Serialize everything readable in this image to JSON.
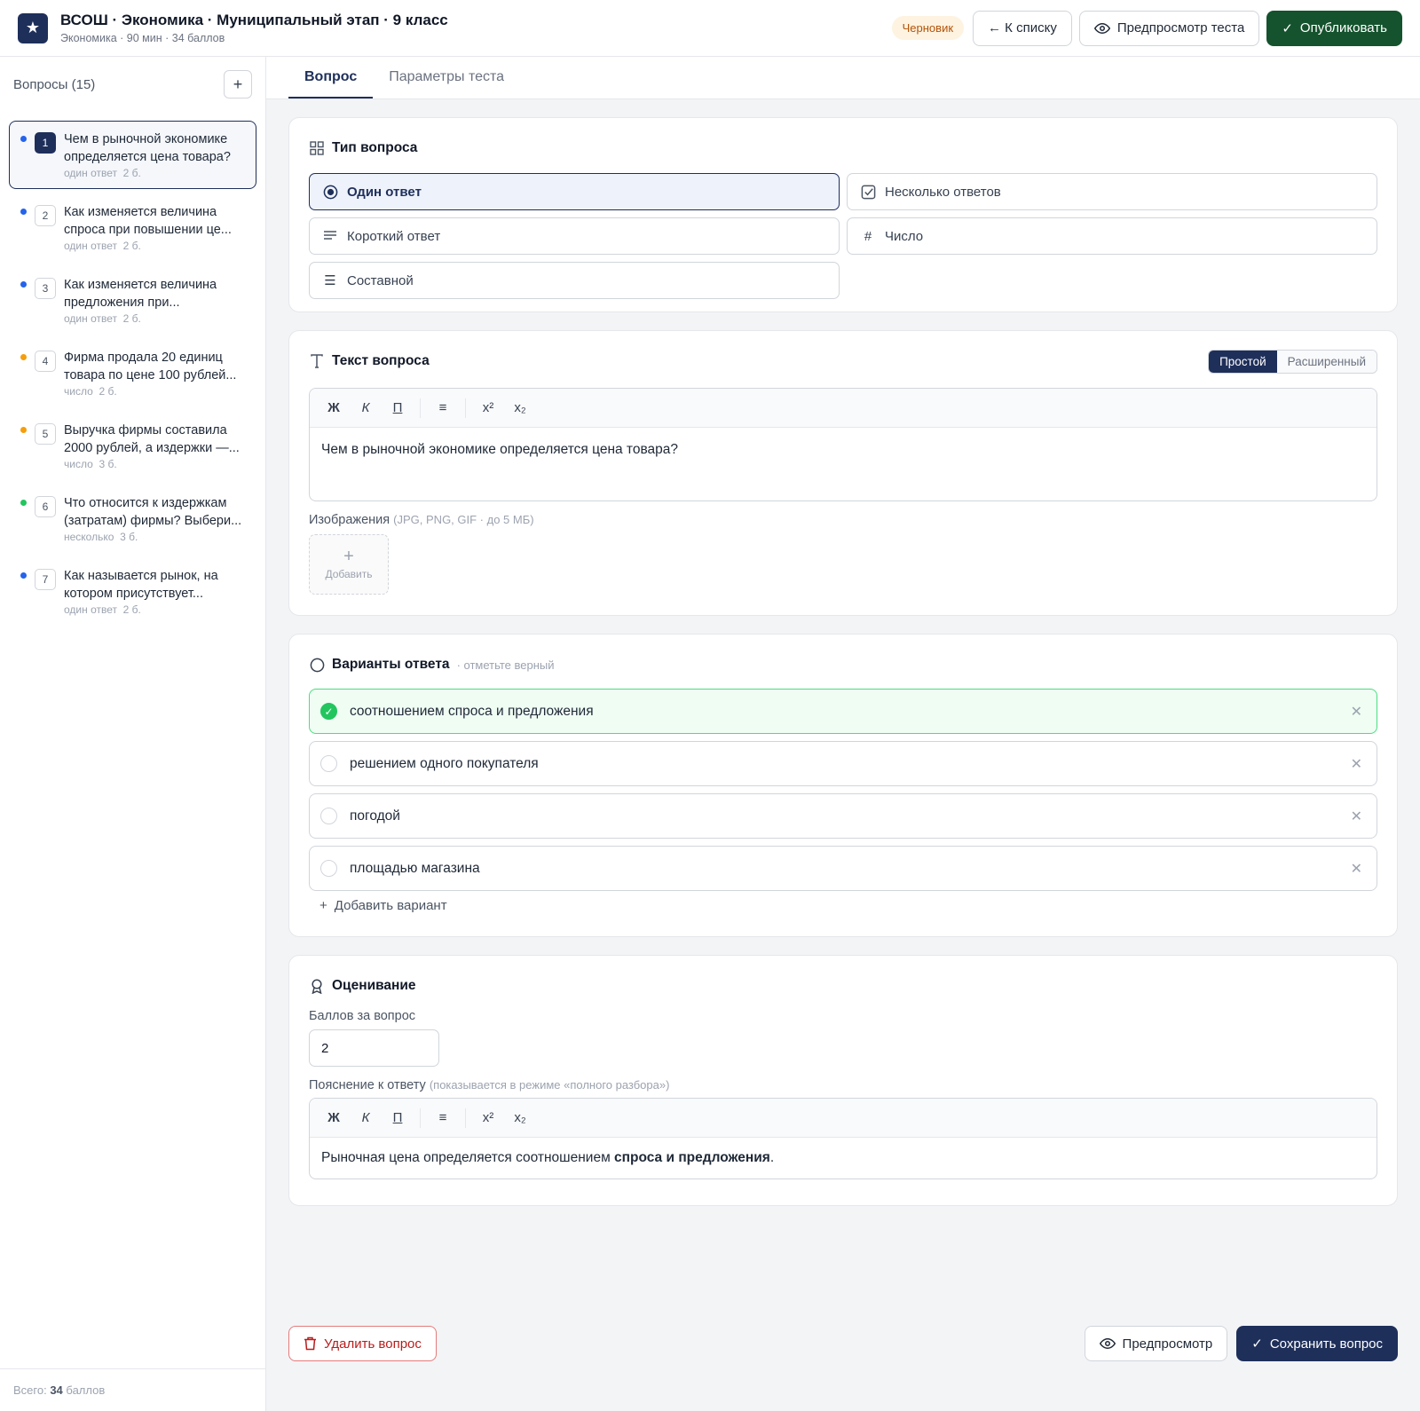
{
  "header": {
    "title": "ВСОШ · Экономика · Муниципальный этап · 9 класс",
    "subtitle": "Экономика · 90 мин · 34 баллов",
    "status": "Черновик",
    "back_label": "← К списку",
    "preview_label": "Предпросмотр теста",
    "publish_label": "Опубликовать",
    "logo_icon": "star-icon"
  },
  "sidebar": {
    "heading": "Вопросы (15)",
    "add_label": "+",
    "footer_prefix": "Всего: ",
    "footer_total": "34",
    "footer_suffix": " баллов",
    "questions": [
      {
        "num": "1",
        "text": "Чем в рыночной экономике определяется цена товара?",
        "type": "один ответ",
        "points": "2 б.",
        "dot": "#2563eb"
      },
      {
        "num": "2",
        "text": "Как изменяется величина спроса при повышении це...",
        "type": "один ответ",
        "points": "2 б.",
        "dot": "#2563eb"
      },
      {
        "num": "3",
        "text": "Как изменяется величина предложения при...",
        "type": "один ответ",
        "points": "2 б.",
        "dot": "#2563eb"
      },
      {
        "num": "4",
        "text": "Фирма продала 20 единиц товара по цене 100 рублей...",
        "type": "число",
        "points": "2 б.",
        "dot": "#f59e0b"
      },
      {
        "num": "5",
        "text": "Выручка фирмы составила 2000 рублей, а издержки —...",
        "type": "число",
        "points": "3 б.",
        "dot": "#f59e0b"
      },
      {
        "num": "6",
        "text": "Что относится к издержкам (затратам) фирмы? Выбери...",
        "type": "несколько",
        "points": "3 б.",
        "dot": "#22c55e"
      },
      {
        "num": "7",
        "text": "Как называется рынок, на котором присутствует...",
        "type": "один ответ",
        "points": "2 б.",
        "dot": "#2563eb"
      }
    ]
  },
  "tabs": {
    "question": "Вопрос",
    "params": "Параметры теста"
  },
  "type_card": {
    "title": "Тип вопроса",
    "options": {
      "single": "Один ответ",
      "multiple": "Несколько ответов",
      "short": "Короткий ответ",
      "number": "Число",
      "compound": "Составной"
    }
  },
  "text_card": {
    "title": "Текст вопроса",
    "mode_simple": "Простой",
    "mode_extended": "Расширенный",
    "toolbar": {
      "bold": "Ж",
      "italic": "К",
      "underline": "П",
      "list": "≡",
      "sup": "x²",
      "sub": "x₂"
    },
    "content": "Чем в рыночной экономике определяется цена товара?",
    "images_label": "Изображения",
    "images_hint": "(JPG, PNG, GIF · до 5 МБ)",
    "add_image_label": "Добавить"
  },
  "answers_card": {
    "title": "Варианты ответа",
    "hint": "· отметьте верный",
    "options": [
      {
        "text": "соотношением спроса и предложения",
        "correct": true
      },
      {
        "text": "решением одного покупателя",
        "correct": false
      },
      {
        "text": "погодой",
        "correct": false
      },
      {
        "text": "площадью магазина",
        "correct": false
      }
    ],
    "add_label": "Добавить вариант"
  },
  "grading_card": {
    "title": "Оценивание",
    "points_label": "Баллов за вопрос",
    "points_value": "2",
    "explain_label": "Пояснение к ответу",
    "explain_hint": "(показывается в режиме «полного разбора»)",
    "explain_text_before": "Рыночная цена определяется соотношением ",
    "explain_text_bold": "спроса и предложения",
    "explain_text_after": "."
  },
  "footer": {
    "delete_label": "Удалить вопрос",
    "preview_label": "Предпросмотр",
    "save_label": "Сохранить вопрос"
  },
  "colors": {
    "brand": "#1e2f5a",
    "publish": "#14532d",
    "correct": "#22c55e",
    "danger": "#b91c1c"
  }
}
